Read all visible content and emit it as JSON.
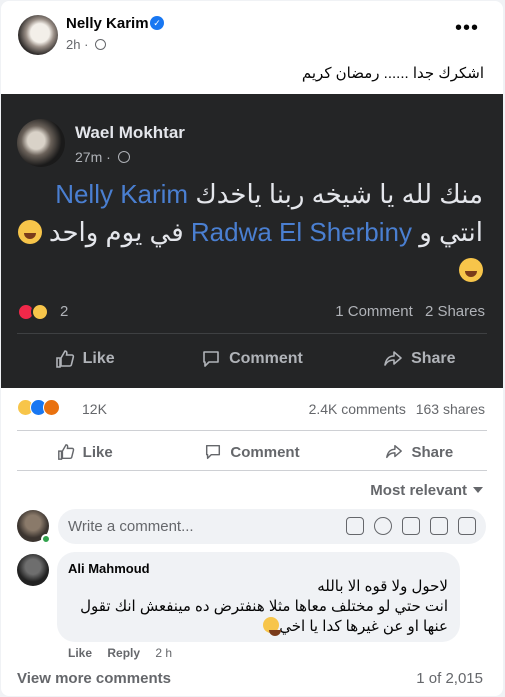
{
  "post": {
    "author": "Nelly Karim",
    "time": "2h",
    "text": "اشكرك جدا ...... رمضان كريم"
  },
  "shared_post": {
    "author": "Wael Mokhtar",
    "time": "27m",
    "text_part1": "منك لله يا شيخه ربنا ياخدك",
    "mention1": "Nelly Karim",
    "text_part2": "انتي و",
    "mention2": "Radwa El Sherbiny",
    "text_part3": "في يوم واحد",
    "reaction_count": "2",
    "comments": "1 Comment",
    "shares": "2 Shares",
    "actions": {
      "like": "Like",
      "comment": "Comment",
      "share": "Share"
    }
  },
  "engagement": {
    "reaction_count": "12K",
    "comments": "2.4K comments",
    "shares": "163 shares"
  },
  "actions": {
    "like": "Like",
    "comment": "Comment",
    "share": "Share"
  },
  "sort": {
    "label": "Most relevant"
  },
  "composer": {
    "placeholder": "Write a comment..."
  },
  "comment": {
    "author": "Ali Mahmoud",
    "line1": "لاحول ولا قوه الا بالله",
    "line2": "انت حتي لو مختلف معاها مثلا هنفترض ده مينفعش انك تقول",
    "line3": "عنها او عن غيرها كدا يا اخي",
    "like": "Like",
    "reply": "Reply",
    "time": "2 h"
  },
  "footer": {
    "view_more": "View more comments",
    "pager": "1 of 2,015"
  },
  "colors": {
    "accent": "#1877f2",
    "mention": "#4a7fd1",
    "dark_bg": "#242526"
  }
}
